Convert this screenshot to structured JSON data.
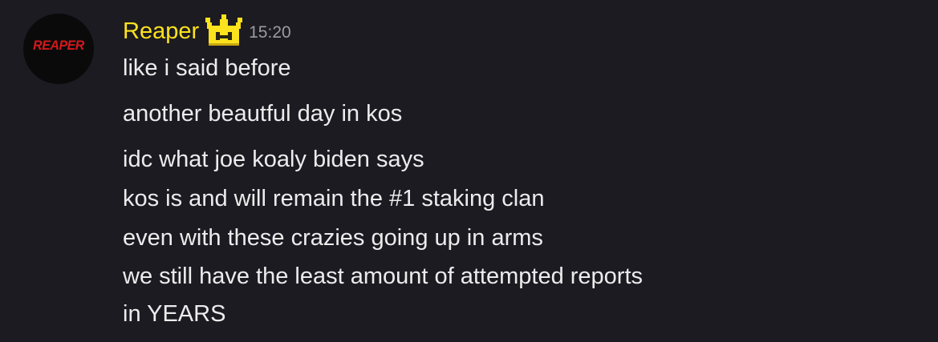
{
  "author": {
    "name": "Reaper",
    "avatar_text": "REAPER",
    "badge_icon": "pixel-crown-icon",
    "name_color": "#fde21e"
  },
  "timestamp": "15:20",
  "messages": [
    "like i said before",
    "another beautful day in kos",
    "idc what joe koaly biden says",
    "kos is and will remain the #1 staking clan",
    "even with these crazies going up in arms",
    "we still have the least amount of attempted reports",
    "in YEARS"
  ],
  "colors": {
    "background": "#1c1b21",
    "text": "#ececed",
    "timestamp": "#9a9ba1",
    "avatar_accent": "#d4181b"
  }
}
